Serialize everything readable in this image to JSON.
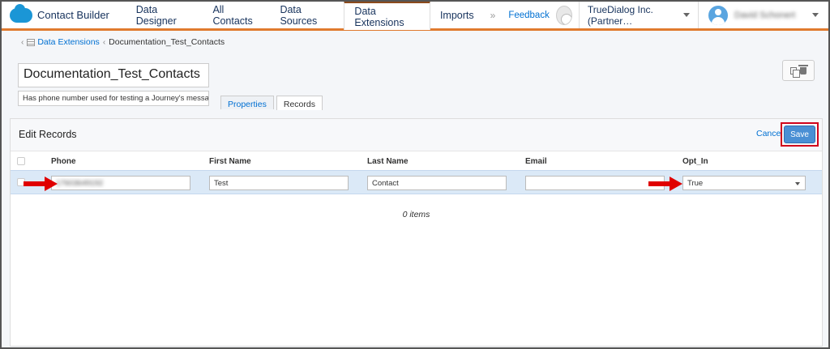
{
  "app": {
    "title": "Contact Builder"
  },
  "nav": {
    "items": [
      {
        "label": "Data Designer"
      },
      {
        "label": "All Contacts"
      },
      {
        "label": "Data Sources"
      },
      {
        "label": "Data Extensions"
      },
      {
        "label": "Imports"
      }
    ],
    "active": "Data Extensions",
    "more": "»"
  },
  "header": {
    "feedback": "Feedback",
    "org": "TrueDialog Inc. (Partner…",
    "user": "David Schonert"
  },
  "breadcrumb": {
    "root": "Data Extensions",
    "current": "Documentation_Test_Contacts",
    "sep": "‹"
  },
  "extension": {
    "name": "Documentation_Test_Contacts",
    "description": "Has phone number used for testing a Journey's message"
  },
  "tabs": [
    {
      "label": "Properties"
    },
    {
      "label": "Records"
    }
  ],
  "panel": {
    "title": "Edit Records",
    "cancel": "Cancel",
    "save": "Save",
    "columns": [
      "Phone",
      "First Name",
      "Last Name",
      "Email",
      "Opt_In"
    ],
    "row": {
      "phone": "17603649192",
      "first_name": "Test",
      "last_name": "Contact",
      "email": "",
      "opt_in": "True"
    },
    "empty": "0 items"
  },
  "colors": {
    "accent": "#e07a2e",
    "link": "#0070d2",
    "highlight": "#d0021b",
    "row": "#dbe9f7"
  }
}
